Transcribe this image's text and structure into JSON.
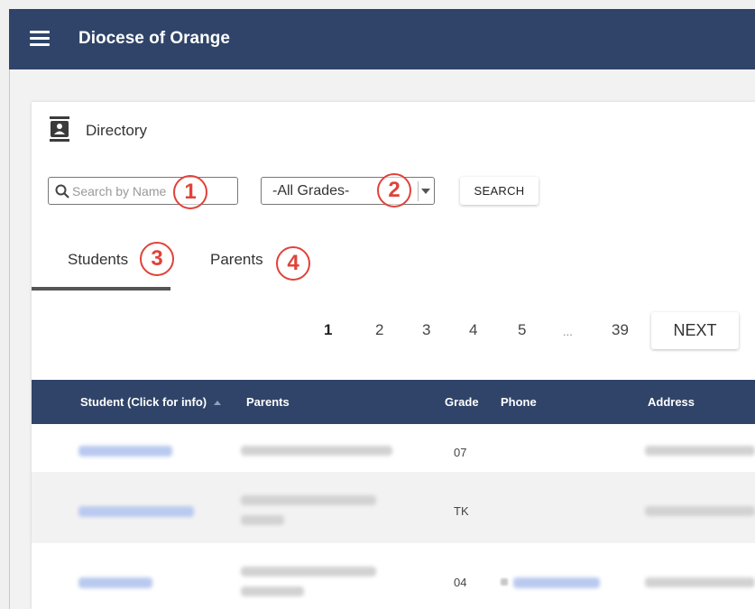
{
  "app": {
    "title": "Diocese of Orange"
  },
  "directory": {
    "label": "Directory"
  },
  "search": {
    "placeholder": "Search by Name"
  },
  "grade_filter": {
    "selected": "-All Grades-"
  },
  "search_button": {
    "label": "SEARCH"
  },
  "badges": [
    "1",
    "2",
    "3",
    "4"
  ],
  "tabs": [
    {
      "label": "Students",
      "active": true
    },
    {
      "label": "Parents",
      "active": false
    }
  ],
  "pagination": {
    "pages": [
      "1",
      "2",
      "3",
      "4",
      "5",
      "...",
      "39"
    ],
    "current": "1",
    "next_label": "NEXT"
  },
  "table": {
    "columns": [
      "Student (Click for info)",
      "Parents",
      "Grade",
      "Phone",
      "Address"
    ],
    "rows": [
      {
        "grade": "07"
      },
      {
        "grade": "TK"
      },
      {
        "grade": "04"
      }
    ]
  },
  "colors": {
    "header": "#2f4468",
    "badge": "#e0423a",
    "link_blurred": "#b9c9ef"
  }
}
